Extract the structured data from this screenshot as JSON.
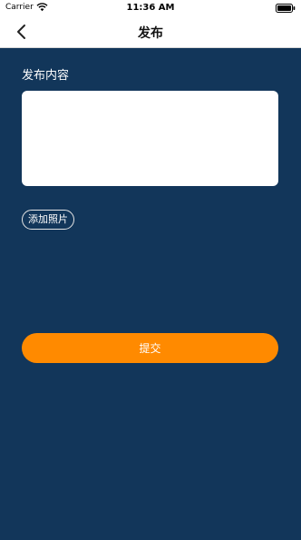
{
  "status_bar": {
    "carrier": "Carrier",
    "time": "11:36 AM",
    "wifi_icon": "wifi-icon",
    "battery_icon": "battery-icon"
  },
  "nav": {
    "title": "发布",
    "back_icon": "chevron-left-icon"
  },
  "form": {
    "content_label": "发布内容",
    "content_value": "",
    "add_photo_label": "添加照片",
    "submit_label": "提交"
  },
  "colors": {
    "background": "#12365a",
    "accent": "#ff8a00",
    "navbar": "#ffffff"
  }
}
